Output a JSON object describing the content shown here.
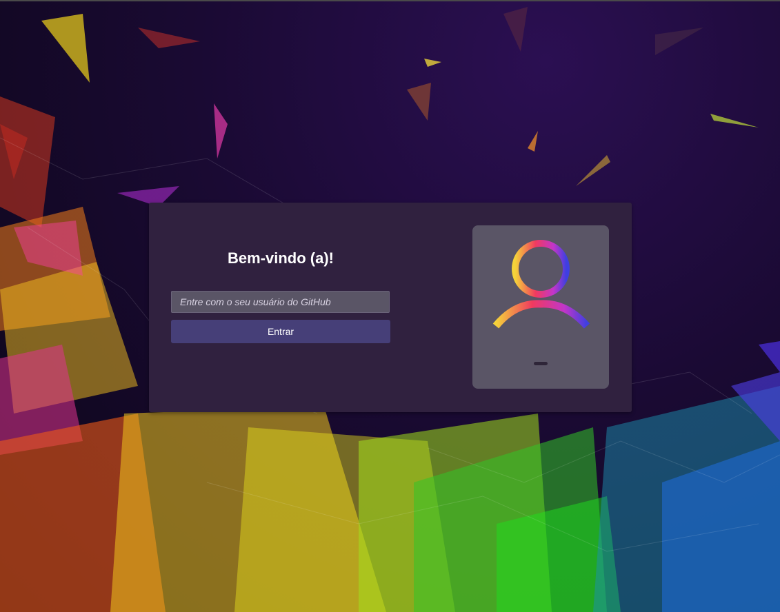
{
  "login": {
    "title": "Bem-vindo (a)!",
    "input_placeholder": "Entre com o seu usuário do GitHub",
    "input_value": "",
    "submit_label": "Entrar"
  },
  "profile": {
    "icon": "user-icon",
    "name": ""
  },
  "colors": {
    "card": "#30213f",
    "panel": "#5a5566",
    "button": "#463f78",
    "icon_gradient": [
      "#f5d33a",
      "#f03a5f",
      "#c236c9",
      "#3f3fe0"
    ]
  }
}
